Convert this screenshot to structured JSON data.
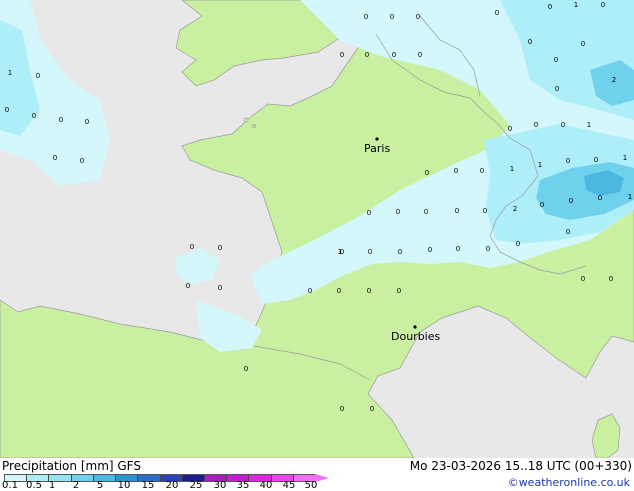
{
  "map": {
    "cities": [
      {
        "name": "Paris"
      },
      {
        "name": "Dourbies"
      }
    ],
    "precip_labels": [
      "0",
      "0",
      "0",
      "0",
      "1",
      "0",
      "0",
      "0",
      "0",
      "0",
      "0",
      "0",
      "0",
      "1",
      "0",
      "0",
      "0",
      "0",
      "0",
      "0",
      "2",
      "0",
      "0",
      "0",
      "0",
      "1",
      "0",
      "0",
      "1",
      "0",
      "0",
      "1",
      "2",
      "0",
      "0",
      "0",
      "1",
      "0",
      "0",
      "1",
      "0",
      "0",
      "0",
      "0",
      "0",
      "0",
      "0",
      "0",
      "0",
      "0",
      "0",
      "0",
      "0",
      "0",
      "0",
      "0",
      "0",
      "0",
      "1",
      "0",
      "0",
      "0",
      "0",
      "0",
      "0",
      "0",
      "0",
      "0"
    ]
  },
  "footer": {
    "title": "Precipitation [mm]  GFS",
    "run_info": "Mo 23-03-2026 15..18 UTC (00+330)",
    "credit": "©weatheronline.co.uk",
    "legend_ticks": [
      "0.1",
      "0.5",
      "1",
      "2",
      "5",
      "10",
      "15",
      "20",
      "25",
      "30",
      "35",
      "40",
      "45",
      "50"
    ],
    "legend_colors": [
      "#d4f7fc",
      "#aeeef8",
      "#96e3f2",
      "#6fd1ec",
      "#4ab8e0",
      "#2f93d2",
      "#2f6cc4",
      "#2a43b6",
      "#1c1a8c",
      "#a81cc0",
      "#c71dd2",
      "#db27e0",
      "#ea44ec",
      "#f56ef3"
    ]
  }
}
